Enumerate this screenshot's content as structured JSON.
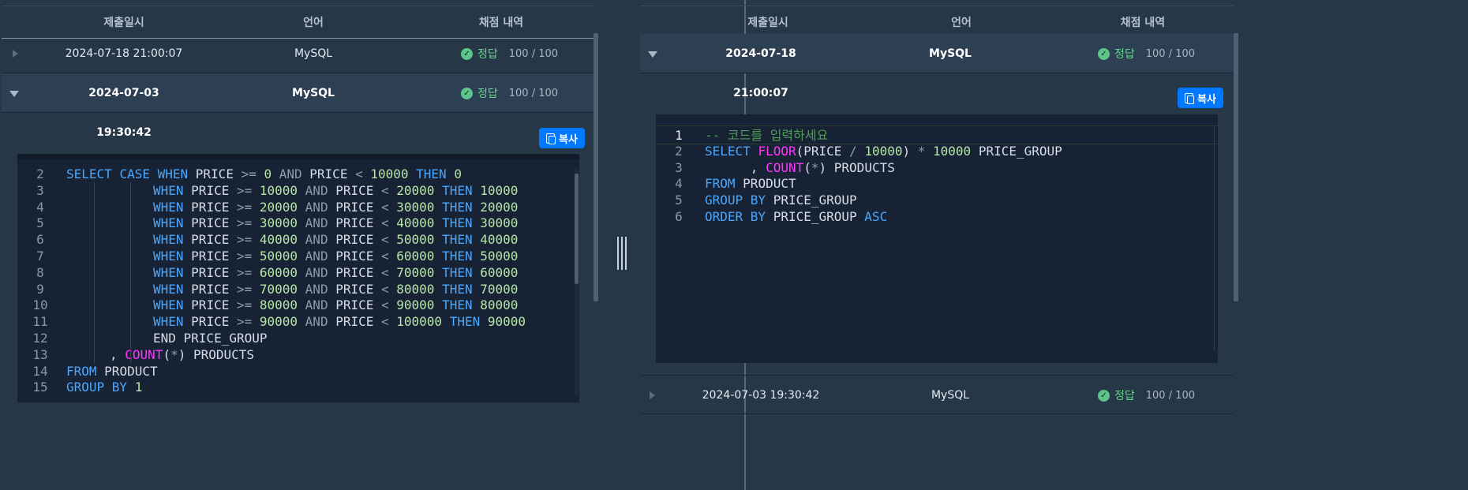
{
  "table": {
    "headers": {
      "date": "제출일시",
      "language": "언어",
      "result": "채점 내역"
    }
  },
  "left": {
    "rows": [
      {
        "date": "2024-07-18 21:00:07",
        "language": "MySQL",
        "status": "정답",
        "score": "100 / 100",
        "expanded": false
      },
      {
        "date": "2024-07-03 19:30:42",
        "language": "MySQL",
        "status": "정답",
        "score": "100 / 100",
        "expanded": true
      }
    ],
    "copy_label": "복사",
    "code": [
      {
        "n": "2",
        "indent": 0,
        "tokens": [
          [
            "kw",
            "SELECT "
          ],
          [
            "kw",
            "CASE "
          ],
          [
            "kw",
            "WHEN "
          ],
          [
            "id",
            "PRICE "
          ],
          [
            "op",
            ">= "
          ],
          [
            "num",
            "0 "
          ],
          [
            "op",
            "AND "
          ],
          [
            "id",
            "PRICE "
          ],
          [
            "op",
            "< "
          ],
          [
            "num",
            "10000 "
          ],
          [
            "kw",
            "THEN "
          ],
          [
            "num",
            "0"
          ]
        ]
      },
      {
        "n": "3",
        "indent": 2,
        "tokens": [
          [
            "kw",
            "WHEN "
          ],
          [
            "id",
            "PRICE "
          ],
          [
            "op",
            ">= "
          ],
          [
            "num",
            "10000 "
          ],
          [
            "op",
            "AND "
          ],
          [
            "id",
            "PRICE "
          ],
          [
            "op",
            "< "
          ],
          [
            "num",
            "20000 "
          ],
          [
            "kw",
            "THEN "
          ],
          [
            "num",
            "10000"
          ]
        ]
      },
      {
        "n": "4",
        "indent": 2,
        "tokens": [
          [
            "kw",
            "WHEN "
          ],
          [
            "id",
            "PRICE "
          ],
          [
            "op",
            ">= "
          ],
          [
            "num",
            "20000 "
          ],
          [
            "op",
            "AND "
          ],
          [
            "id",
            "PRICE "
          ],
          [
            "op",
            "< "
          ],
          [
            "num",
            "30000 "
          ],
          [
            "kw",
            "THEN "
          ],
          [
            "num",
            "20000"
          ]
        ]
      },
      {
        "n": "5",
        "indent": 2,
        "tokens": [
          [
            "kw",
            "WHEN "
          ],
          [
            "id",
            "PRICE "
          ],
          [
            "op",
            ">= "
          ],
          [
            "num",
            "30000 "
          ],
          [
            "op",
            "AND "
          ],
          [
            "id",
            "PRICE "
          ],
          [
            "op",
            "< "
          ],
          [
            "num",
            "40000 "
          ],
          [
            "kw",
            "THEN "
          ],
          [
            "num",
            "30000"
          ]
        ]
      },
      {
        "n": "6",
        "indent": 2,
        "tokens": [
          [
            "kw",
            "WHEN "
          ],
          [
            "id",
            "PRICE "
          ],
          [
            "op",
            ">= "
          ],
          [
            "num",
            "40000 "
          ],
          [
            "op",
            "AND "
          ],
          [
            "id",
            "PRICE "
          ],
          [
            "op",
            "< "
          ],
          [
            "num",
            "50000 "
          ],
          [
            "kw",
            "THEN "
          ],
          [
            "num",
            "40000"
          ]
        ]
      },
      {
        "n": "7",
        "indent": 2,
        "tokens": [
          [
            "kw",
            "WHEN "
          ],
          [
            "id",
            "PRICE "
          ],
          [
            "op",
            ">= "
          ],
          [
            "num",
            "50000 "
          ],
          [
            "op",
            "AND "
          ],
          [
            "id",
            "PRICE "
          ],
          [
            "op",
            "< "
          ],
          [
            "num",
            "60000 "
          ],
          [
            "kw",
            "THEN "
          ],
          [
            "num",
            "50000"
          ]
        ]
      },
      {
        "n": "8",
        "indent": 2,
        "tokens": [
          [
            "kw",
            "WHEN "
          ],
          [
            "id",
            "PRICE "
          ],
          [
            "op",
            ">= "
          ],
          [
            "num",
            "60000 "
          ],
          [
            "op",
            "AND "
          ],
          [
            "id",
            "PRICE "
          ],
          [
            "op",
            "< "
          ],
          [
            "num",
            "70000 "
          ],
          [
            "kw",
            "THEN "
          ],
          [
            "num",
            "60000"
          ]
        ]
      },
      {
        "n": "9",
        "indent": 2,
        "tokens": [
          [
            "kw",
            "WHEN "
          ],
          [
            "id",
            "PRICE "
          ],
          [
            "op",
            ">= "
          ],
          [
            "num",
            "70000 "
          ],
          [
            "op",
            "AND "
          ],
          [
            "id",
            "PRICE "
          ],
          [
            "op",
            "< "
          ],
          [
            "num",
            "80000 "
          ],
          [
            "kw",
            "THEN "
          ],
          [
            "num",
            "70000"
          ]
        ]
      },
      {
        "n": "10",
        "indent": 2,
        "tokens": [
          [
            "kw",
            "WHEN "
          ],
          [
            "id",
            "PRICE "
          ],
          [
            "op",
            ">= "
          ],
          [
            "num",
            "80000 "
          ],
          [
            "op",
            "AND "
          ],
          [
            "id",
            "PRICE "
          ],
          [
            "op",
            "< "
          ],
          [
            "num",
            "90000 "
          ],
          [
            "kw",
            "THEN "
          ],
          [
            "num",
            "80000"
          ]
        ]
      },
      {
        "n": "11",
        "indent": 2,
        "tokens": [
          [
            "kw",
            "WHEN "
          ],
          [
            "id",
            "PRICE "
          ],
          [
            "op",
            ">= "
          ],
          [
            "num",
            "90000 "
          ],
          [
            "op",
            "AND "
          ],
          [
            "id",
            "PRICE "
          ],
          [
            "op",
            "< "
          ],
          [
            "num",
            "100000 "
          ],
          [
            "kw",
            "THEN "
          ],
          [
            "num",
            "90000"
          ]
        ]
      },
      {
        "n": "12",
        "indent": 2,
        "tokens": [
          [
            "id",
            "END PRICE_GROUP"
          ]
        ]
      },
      {
        "n": "13",
        "indent": 1,
        "tokens": [
          [
            "id",
            ", "
          ],
          [
            "fn",
            "COUNT"
          ],
          [
            "id",
            "("
          ],
          [
            "op",
            "*"
          ],
          [
            "id",
            ") PRODUCTS"
          ]
        ]
      },
      {
        "n": "14",
        "indent": 0,
        "tokens": [
          [
            "kw",
            "FROM "
          ],
          [
            "id",
            "PRODUCT"
          ]
        ]
      },
      {
        "n": "15",
        "indent": 0,
        "tokens": [
          [
            "kw",
            "GROUP BY "
          ],
          [
            "num",
            "1"
          ]
        ]
      }
    ]
  },
  "right": {
    "rows": [
      {
        "date": "2024-07-18 21:00:07",
        "language": "MySQL",
        "status": "정답",
        "score": "100 / 100",
        "expanded": true
      },
      {
        "date": "2024-07-03 19:30:42",
        "language": "MySQL",
        "status": "정답",
        "score": "100 / 100",
        "expanded": false
      }
    ],
    "copy_label": "복사",
    "code": [
      {
        "n": "1",
        "indent": 0,
        "tokens": [
          [
            "cm",
            "-- 코드를 입력하세요"
          ]
        ]
      },
      {
        "n": "2",
        "indent": 0,
        "tokens": [
          [
            "kw",
            "SELECT "
          ],
          [
            "fn",
            "FLOOR"
          ],
          [
            "id",
            "(PRICE "
          ],
          [
            "op",
            "/ "
          ],
          [
            "num",
            "10000"
          ],
          [
            "id",
            ") "
          ],
          [
            "op",
            "* "
          ],
          [
            "num",
            "10000 "
          ],
          [
            "id",
            "PRICE_GROUP"
          ]
        ]
      },
      {
        "n": "3",
        "indent": 0,
        "tokens": [
          [
            "id",
            "      , "
          ],
          [
            "fn",
            "COUNT"
          ],
          [
            "id",
            "("
          ],
          [
            "op",
            "*"
          ],
          [
            "id",
            ") PRODUCTS"
          ]
        ]
      },
      {
        "n": "4",
        "indent": 0,
        "tokens": [
          [
            "kw",
            "FROM "
          ],
          [
            "id",
            "PRODUCT"
          ]
        ]
      },
      {
        "n": "5",
        "indent": 0,
        "tokens": [
          [
            "kw",
            "GROUP BY "
          ],
          [
            "id",
            "PRICE_GROUP"
          ]
        ]
      },
      {
        "n": "6",
        "indent": 0,
        "tokens": [
          [
            "kw",
            "ORDER BY "
          ],
          [
            "id",
            "PRICE_GROUP "
          ],
          [
            "kw",
            "ASC"
          ]
        ]
      }
    ]
  },
  "colors": {
    "background": "#263747",
    "editor": "#172334",
    "accent": "#0078ff",
    "correct": "#5cc489"
  },
  "icons": {
    "check": "check-circle-icon",
    "copy": "copy-icon",
    "expand": "triangle-icon"
  }
}
